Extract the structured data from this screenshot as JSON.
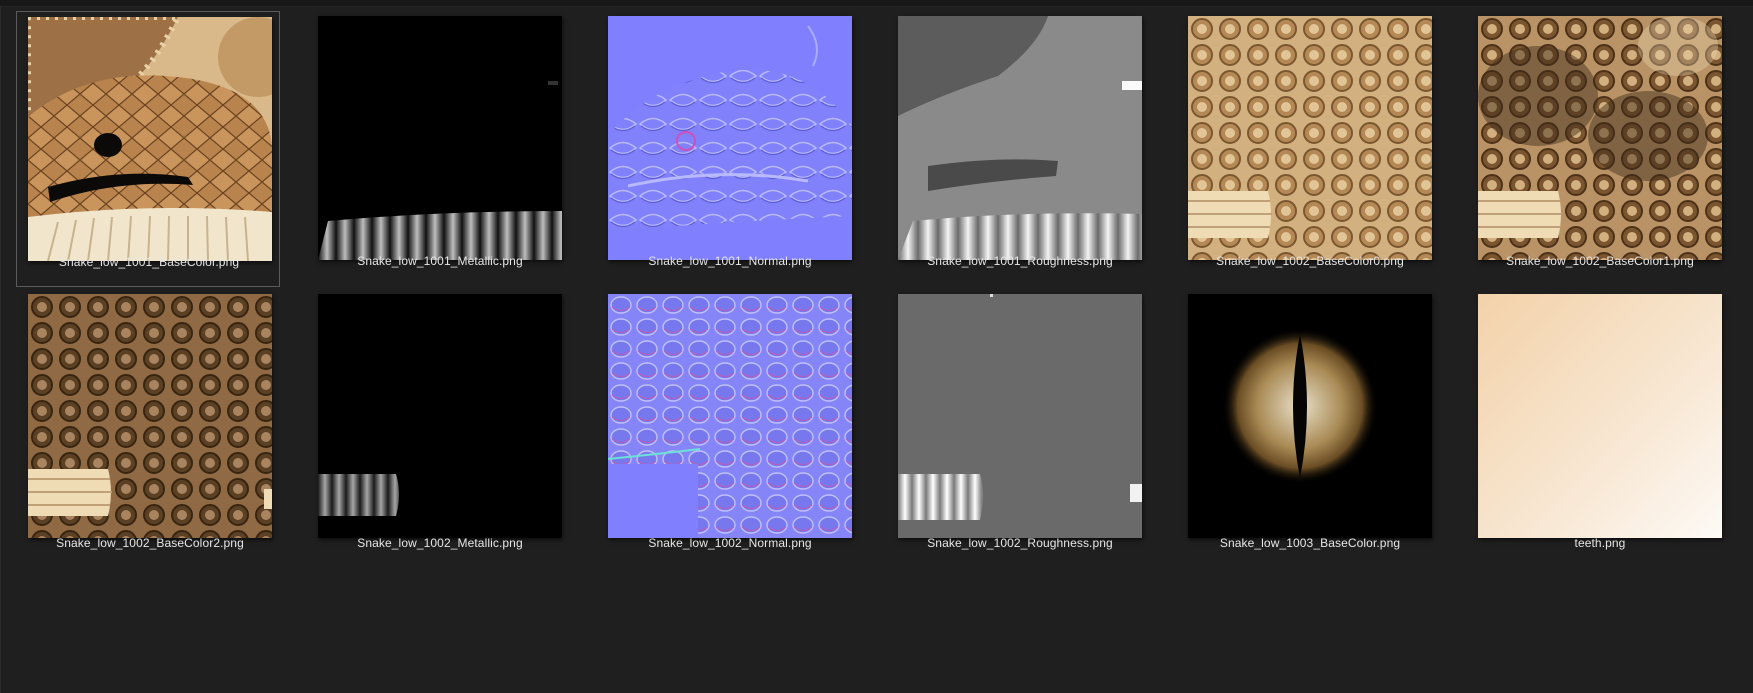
{
  "files": [
    {
      "name": "Snake_low_1001_BaseColor.png",
      "icon": "image-thumbnail-basecolor-icon",
      "selected": true
    },
    {
      "name": "Snake_low_1001_Metallic.png",
      "icon": "image-thumbnail-metallic-icon",
      "selected": false
    },
    {
      "name": "Snake_low_1001_Normal.png",
      "icon": "image-thumbnail-normal-icon",
      "selected": false
    },
    {
      "name": "Snake_low_1001_Roughness.png",
      "icon": "image-thumbnail-roughness-icon",
      "selected": false
    },
    {
      "name": "Snake_low_1002_BaseColor0.png",
      "icon": "image-thumbnail-basecolor-icon",
      "selected": false
    },
    {
      "name": "Snake_low_1002_BaseColor1.png",
      "icon": "image-thumbnail-basecolor-icon",
      "selected": false
    },
    {
      "name": "Snake_low_1002_BaseColor2.png",
      "icon": "image-thumbnail-basecolor-icon",
      "selected": false
    },
    {
      "name": "Snake_low_1002_Metallic.png",
      "icon": "image-thumbnail-metallic-icon",
      "selected": false
    },
    {
      "name": "Snake_low_1002_Normal.png",
      "icon": "image-thumbnail-normal-icon",
      "selected": false
    },
    {
      "name": "Snake_low_1002_Roughness.png",
      "icon": "image-thumbnail-roughness-icon",
      "selected": false
    },
    {
      "name": "Snake_low_1003_BaseColor.png",
      "icon": "image-thumbnail-eye-icon",
      "selected": false
    },
    {
      "name": "teeth.png",
      "icon": "image-thumbnail-teeth-icon",
      "selected": false
    }
  ],
  "colors": {
    "background": "#1f1f1f",
    "label_text": "#e6e6e6",
    "selection_border": "#5b5b5b",
    "normal_map_blue": "#8080ff"
  }
}
